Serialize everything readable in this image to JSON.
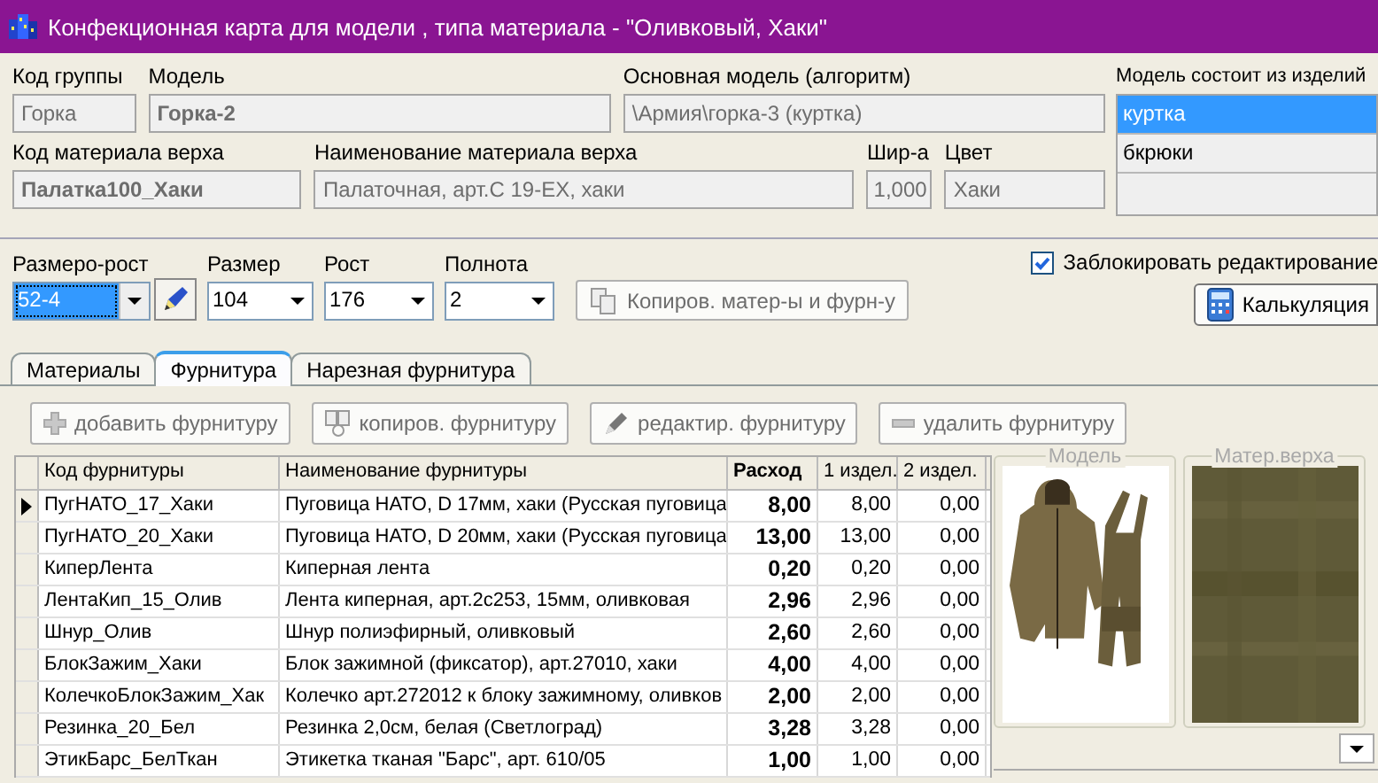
{
  "window": {
    "title": "Конфекционная карта для модели , типа материала - \"Оливковый, Хаки\""
  },
  "model_row": [
    {
      "label": "Код группы",
      "value": "Горка",
      "bold": false
    },
    {
      "label": "Модель",
      "value": "Горка-2",
      "bold": true
    },
    {
      "label": "Основная модель (алгоритм)",
      "value": "\\Армия\\горка-3 (куртка)",
      "bold": false
    }
  ],
  "material_row": [
    {
      "label": "Код материала верха",
      "value": "Палатка100_Хаки",
      "bold": true
    },
    {
      "label": "Наименование материала верха",
      "value": "Палаточная, арт.С 19-ЕХ, хаки",
      "bold": false
    },
    {
      "label": "Шир-а",
      "value": "1,000",
      "bold": false
    },
    {
      "label": "Цвет",
      "value": "Хаки",
      "bold": false
    }
  ],
  "components": {
    "label": "Модель состоит из изделий",
    "items": [
      {
        "label": "куртка",
        "selected": true
      },
      {
        "label": "бкрюки",
        "selected": false
      }
    ]
  },
  "size_controls": [
    {
      "label": "Размеро-рост",
      "value": "52-4",
      "focused": true
    },
    {
      "label": "Размер",
      "value": "104",
      "focused": false
    },
    {
      "label": "Рост",
      "value": "176",
      "focused": false
    },
    {
      "label": "Полнота",
      "value": "2",
      "focused": false
    }
  ],
  "copy_button": "Копиров. матер-ы и фурн-у",
  "lock_edit": {
    "label": "Заблокировать редактирование",
    "checked": true
  },
  "calc_button": "Калькуляция",
  "tabs": [
    {
      "label": "Материалы",
      "selected": false
    },
    {
      "label": "Фурнитура",
      "selected": true
    },
    {
      "label": "Нарезная фурнитура",
      "selected": false
    }
  ],
  "toolbar": [
    {
      "label": "добавить фурнитуру",
      "kind": "plus"
    },
    {
      "label": "копиров. фурнитуру",
      "kind": "copy"
    },
    {
      "label": "редактир. фурнитуру",
      "kind": "pencil"
    },
    {
      "label": "удалить фурнитуру",
      "kind": "minus"
    }
  ],
  "table": {
    "columns": [
      "Код фурнитуры",
      "Наименование фурнитуры",
      "Расход",
      "1 издел.",
      "2 издел."
    ],
    "rows": [
      {
        "current": true,
        "cells": [
          "ПугНАТО_17_Хаки",
          "Пуговица НАТО, D 17мм, хаки (Русская пуговица",
          "8,00",
          "8,00",
          "0,00"
        ]
      },
      {
        "current": false,
        "cells": [
          "ПугНАТО_20_Хаки",
          "Пуговица НАТО, D 20мм, хаки (Русская пуговица",
          "13,00",
          "13,00",
          "0,00"
        ]
      },
      {
        "current": false,
        "cells": [
          "КиперЛента",
          "Киперная лента",
          "0,20",
          "0,20",
          "0,00"
        ]
      },
      {
        "current": false,
        "cells": [
          "ЛентаКип_15_Олив",
          "Лента киперная, арт.2с253, 15мм, оливковая",
          "2,96",
          "2,96",
          "0,00"
        ]
      },
      {
        "current": false,
        "cells": [
          "Шнур_Олив",
          "Шнур полиэфирный, оливковый",
          "2,60",
          "2,60",
          "0,00"
        ]
      },
      {
        "current": false,
        "cells": [
          "БлокЗажим_Хаки",
          "Блок зажимной (фиксатор), арт.27010, хаки",
          "4,00",
          "4,00",
          "0,00"
        ]
      },
      {
        "current": false,
        "cells": [
          "КолечкоБлокЗажим_Хак",
          "Колечко арт.272012 к блоку зажимному, оливков",
          "2,00",
          "2,00",
          "0,00"
        ]
      },
      {
        "current": false,
        "cells": [
          "Резинка_20_Бел",
          "Резинка 2,0см, белая (Светлоград)",
          "3,28",
          "3,28",
          "0,00"
        ]
      },
      {
        "current": false,
        "cells": [
          "ЭтикБарс_БелТкан",
          "Этикетка тканая \"Барс\", арт. 610/05",
          "1,00",
          "1,00",
          "0,00"
        ]
      }
    ]
  },
  "images": [
    {
      "caption": "Модель",
      "kind": "picture"
    },
    {
      "caption": "Матер.верха",
      "kind": "picture"
    }
  ]
}
